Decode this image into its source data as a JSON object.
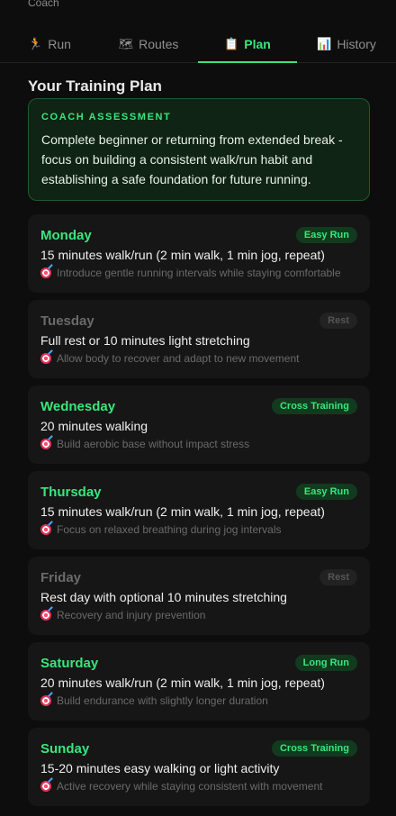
{
  "header": {
    "subtitle": "Coach"
  },
  "tabs": [
    {
      "icon": "🏃",
      "label": "Run",
      "active": false
    },
    {
      "icon": "🗺",
      "label": "Routes",
      "active": false
    },
    {
      "icon": "📋",
      "label": "Plan",
      "active": true
    },
    {
      "icon": "📊",
      "label": "History",
      "active": false
    }
  ],
  "plan": {
    "title": "Your Training Plan",
    "assessment": {
      "label": "COACH ASSESSMENT",
      "text": "Complete beginner or returning from extended break - focus on building a consistent walk/run habit and establishing a safe foundation for future running."
    },
    "days": [
      {
        "day": "Monday",
        "badge": "Easy Run",
        "rest": false,
        "workout": "15 minutes walk/run (2 min walk, 1 min jog, repeat)",
        "tip": "Introduce gentle running intervals while staying comfortable"
      },
      {
        "day": "Tuesday",
        "badge": "Rest",
        "rest": true,
        "workout": "Full rest or 10 minutes light stretching",
        "tip": "Allow body to recover and adapt to new movement"
      },
      {
        "day": "Wednesday",
        "badge": "Cross Training",
        "rest": false,
        "workout": "20 minutes walking",
        "tip": "Build aerobic base without impact stress"
      },
      {
        "day": "Thursday",
        "badge": "Easy Run",
        "rest": false,
        "workout": "15 minutes walk/run (2 min walk, 1 min jog, repeat)",
        "tip": "Focus on relaxed breathing during jog intervals"
      },
      {
        "day": "Friday",
        "badge": "Rest",
        "rest": true,
        "workout": "Rest day with optional 10 minutes stretching",
        "tip": "Recovery and injury prevention"
      },
      {
        "day": "Saturday",
        "badge": "Long Run",
        "rest": false,
        "workout": "20 minutes walk/run (2 min walk, 1 min jog, repeat)",
        "tip": "Build endurance with slightly longer duration"
      },
      {
        "day": "Sunday",
        "badge": "Cross Training",
        "rest": false,
        "workout": "15-20 minutes easy walking or light activity",
        "tip": "Active recovery while staying consistent with movement"
      }
    ]
  },
  "colors": {
    "accent": "#39e67b",
    "background": "#0d0d0d",
    "card": "#161616",
    "assessment_bg": "#0f2414"
  },
  "icons": {
    "tip": "target-icon"
  }
}
